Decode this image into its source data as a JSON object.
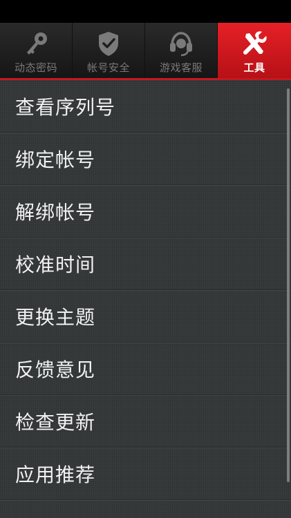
{
  "tabs": [
    {
      "label": "动态密码",
      "icon": "key-icon",
      "active": false
    },
    {
      "label": "帐号安全",
      "icon": "shield-icon",
      "active": false
    },
    {
      "label": "游戏客服",
      "icon": "headset-icon",
      "active": false
    },
    {
      "label": "工具",
      "icon": "tools-icon",
      "active": true
    }
  ],
  "menu": {
    "items": [
      {
        "label": "查看序列号"
      },
      {
        "label": "绑定帐号"
      },
      {
        "label": "解绑帐号"
      },
      {
        "label": "校准时间"
      },
      {
        "label": "更换主题"
      },
      {
        "label": "反馈意见"
      },
      {
        "label": "检查更新"
      },
      {
        "label": "应用推荐"
      }
    ]
  },
  "colors": {
    "accent": "#e62027",
    "tab_text": "#7a7a7a",
    "list_background": "#353838",
    "item_text": "#f2f2f2"
  }
}
